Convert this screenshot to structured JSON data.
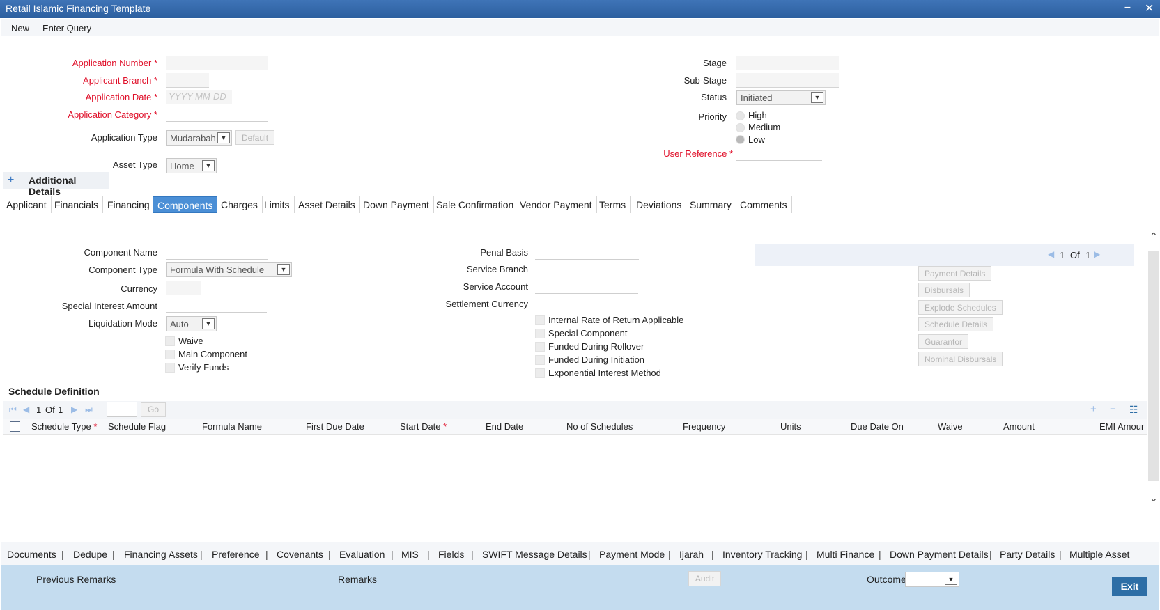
{
  "window": {
    "title": "Retail Islamic Financing Template"
  },
  "toolbar": {
    "new": "New",
    "enter_query": "Enter Query"
  },
  "header_left": {
    "application_number": "Application Number",
    "applicant_branch": "Applicant Branch",
    "application_date": "Application Date",
    "application_date_placeholder": "YYYY-MM-DD",
    "application_category": "Application Category",
    "application_type": "Application Type",
    "application_type_value": "Mudarabah",
    "default_button": "Default",
    "asset_type": "Asset Type",
    "asset_type_value": "Home",
    "required_mark": "*"
  },
  "header_right": {
    "stage": "Stage",
    "sub_stage": "Sub-Stage",
    "status": "Status",
    "status_value": "Initiated",
    "priority": "Priority",
    "priority_options": [
      "High",
      "Medium",
      "Low"
    ],
    "user_reference": "User Reference"
  },
  "additional_details": {
    "plus": "+",
    "label": "Additional Details"
  },
  "tabs": [
    "Applicant",
    "Financials",
    "Financing",
    "Components",
    "Charges",
    "Limits",
    "Asset Details",
    "Down Payment",
    "Sale Confirmation",
    "Vendor Payment",
    "Terms",
    "Deviations",
    "Summary",
    "Comments"
  ],
  "components": {
    "component_name": "Component Name",
    "component_type": "Component Type",
    "component_type_value": "Formula With Schedule",
    "currency": "Currency",
    "special_interest_amount": "Special Interest Amount",
    "liquidation_mode": "Liquidation Mode",
    "liquidation_mode_value": "Auto",
    "checks_left": [
      "Waive",
      "Main Component",
      "Verify Funds"
    ],
    "penal_basis": "Penal Basis",
    "service_branch": "Service Branch",
    "service_account": "Service Account",
    "settlement_currency": "Settlement Currency",
    "checks_right": [
      "Internal Rate of Return Applicable",
      "Special Component",
      "Funded During Rollover",
      "Funded During Initiation",
      "Exponential Interest Method"
    ]
  },
  "pager": {
    "current": "1",
    "of": "Of",
    "total": "1"
  },
  "side_buttons": [
    "Payment Details",
    "Disbursals",
    "Explode Schedules",
    "Schedule Details",
    "Guarantor",
    "Nominal Disbursals"
  ],
  "schedule": {
    "title": "Schedule Definition",
    "pager_current": "1",
    "pager_of": "Of",
    "pager_total": "1",
    "go": "Go",
    "columns": [
      "Schedule Type",
      "Schedule Flag",
      "Formula Name",
      "First Due Date",
      "Start Date",
      "End Date",
      "No of Schedules",
      "Frequency",
      "Units",
      "Due Date On",
      "Waive",
      "Amount",
      "EMI Amour"
    ]
  },
  "bottom_links": [
    "Documents",
    "Dedupe",
    "Financing Assets",
    "Preference",
    "Covenants",
    "Evaluation",
    "MIS",
    "Fields",
    "SWIFT Message Details",
    "Payment Mode",
    "Ijarah",
    "Inventory Tracking",
    "Multi Finance",
    "Down Payment Details",
    "Party Details",
    "Multiple Asset"
  ],
  "footer": {
    "previous_remarks": "Previous Remarks",
    "remarks": "Remarks",
    "audit": "Audit",
    "outcome": "Outcome",
    "exit": "Exit"
  }
}
